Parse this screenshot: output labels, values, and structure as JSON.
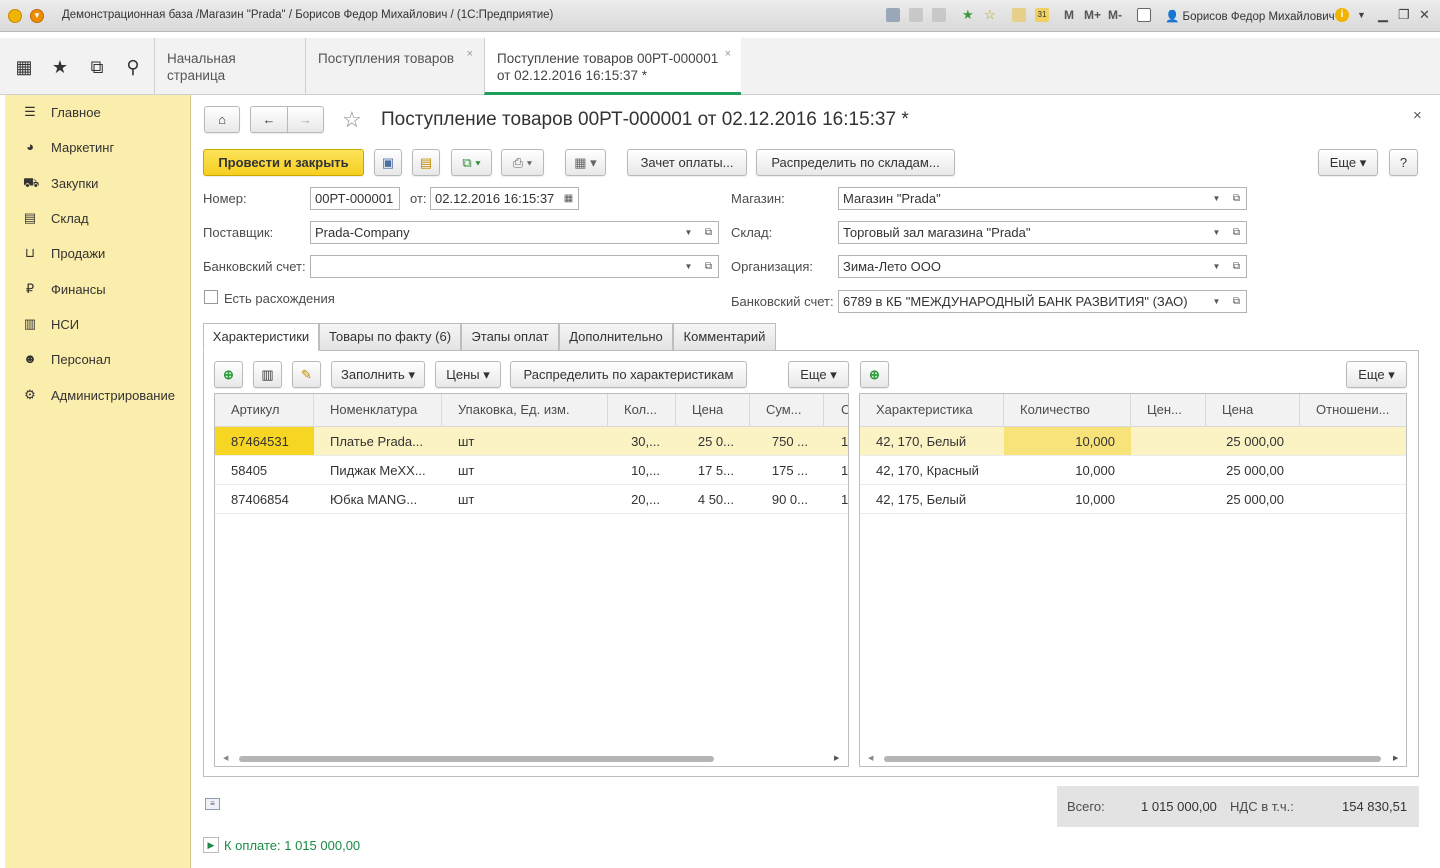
{
  "window": {
    "title": "Демонстрационная база /Магазин \"Prada\" / Борисов Федор Михайлович / (1С:Предприятие)",
    "user": "Борисов Федор Михайлович",
    "m": "M",
    "mplus": "M+",
    "mminus": "M-"
  },
  "icons": {
    "apps": "grid-icon",
    "star": "star-icon",
    "history": "history-icon",
    "search": "search-icon"
  },
  "tabs": [
    {
      "label": "Начальная страница"
    },
    {
      "label": "Поступления товаров"
    },
    {
      "label": "Поступление товаров 00РТ-000001\nот 02.12.2016 16:15:37 *"
    }
  ],
  "sidebar": {
    "items": [
      {
        "label": "Главное"
      },
      {
        "label": "Маркетинг"
      },
      {
        "label": "Закупки"
      },
      {
        "label": "Склад"
      },
      {
        "label": "Продажи"
      },
      {
        "label": "Финансы"
      },
      {
        "label": "НСИ"
      },
      {
        "label": "Персонал"
      },
      {
        "label": "Администрирование"
      }
    ]
  },
  "doc": {
    "title": "Поступление товаров 00РТ-000001 от 02.12.2016 16:15:37 *",
    "toolbar": {
      "post_close": "Провести и закрыть",
      "zachet": "Зачет оплаты...",
      "distribute": "Распределить по складам...",
      "more": "Еще",
      "help": "?"
    },
    "fields": {
      "number_label": "Номер:",
      "number": "00РТ-000001",
      "from_label": "от:",
      "date": "02.12.2016 16:15:37",
      "supplier_label": "Поставщик:",
      "supplier": "Prada-Company",
      "bank_label": "Банковский счет:",
      "bank": "",
      "discrepancy_label": "Есть расхождения",
      "shop_label": "Магазин:",
      "shop": "Магазин \"Prada\"",
      "warehouse_label": "Склад:",
      "warehouse": "Торговый зал магазина \"Prada\"",
      "org_label": "Организация:",
      "org": "Зима-Лето ООО",
      "bank2_label": "Банковский счет:",
      "bank2": "6789 в КБ \"МЕЖДУНАРОДНЫЙ БАНК РАЗВИТИЯ\" (ЗАО)"
    },
    "formtabs": [
      {
        "label": "Характеристики"
      },
      {
        "label": "Товары по факту (6)"
      },
      {
        "label": "Этапы оплат"
      },
      {
        "label": "Дополнительно"
      },
      {
        "label": "Комментарий"
      }
    ],
    "left_toolbar": {
      "fill": "Заполнить",
      "prices": "Цены",
      "distribute": "Распределить по характеристикам",
      "more": "Еще"
    },
    "left_table": {
      "headers": [
        "Артикул",
        "Номенклатура",
        "Упаковка, Ед. изм.",
        "Кол...",
        "Цена",
        "Сум...",
        "С"
      ],
      "rows": [
        [
          "87464531",
          "Платье Prada...",
          "шт",
          "30,...",
          "25 0...",
          "750 ...",
          "1"
        ],
        [
          "58405",
          "Пиджак MeXX...",
          "шт",
          "10,...",
          "17 5...",
          "175 ...",
          "1"
        ],
        [
          "87406854",
          "Юбка MANG...",
          "шт",
          "20,...",
          "4 50...",
          "90 0...",
          "1"
        ]
      ]
    },
    "right_toolbar": {
      "more": "Еще"
    },
    "right_table": {
      "headers": [
        "Характеристика",
        "Количество",
        "Цен...",
        "Цена",
        "Отношени..."
      ],
      "rows": [
        [
          "42, 170, Белый",
          "10,000",
          "",
          "25 000,00",
          ""
        ],
        [
          "42, 170, Красный",
          "10,000",
          "",
          "25 000,00",
          ""
        ],
        [
          "42, 175, Белый",
          "10,000",
          "",
          "25 000,00",
          ""
        ]
      ]
    },
    "totals": {
      "total_label": "Всего:",
      "total": "1 015 000,00",
      "vat_label": "НДС в т.ч.:",
      "vat": "154 830,51"
    },
    "payment": "К оплате: 1 015 000,00"
  },
  "colors": {
    "accent": "#f6d622",
    "sidebar": "#fbedab",
    "active_tab": "#1ea05a",
    "link": "#1a8a45"
  }
}
